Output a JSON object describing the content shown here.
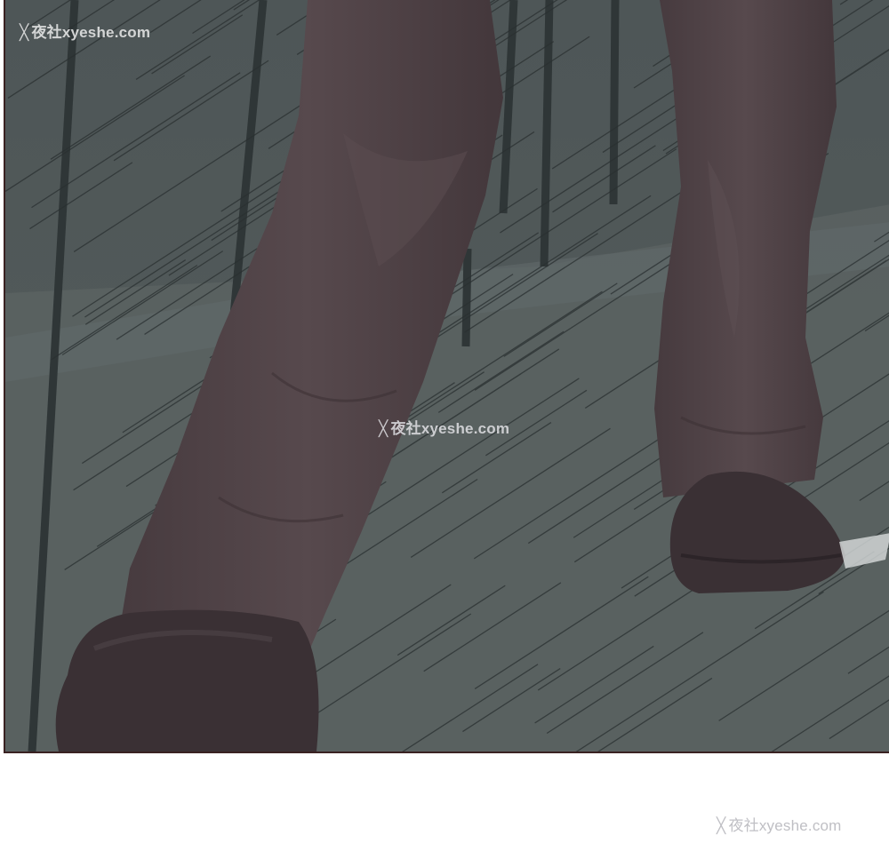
{
  "watermarks": {
    "mark_glyph": "╳",
    "text": "夜社xyeshe.com"
  },
  "colors": {
    "background": "#4a5152",
    "floor_light": "#5c6463",
    "trousers": "#4f4246",
    "shoe": "#3a3034",
    "panel_border": "#3a2222",
    "page": "#ffffff"
  }
}
